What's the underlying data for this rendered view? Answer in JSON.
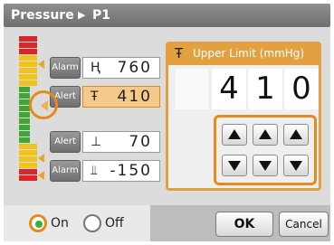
{
  "title": {
    "section": "Pressure",
    "separator": "▶",
    "channel": "P1"
  },
  "limits": [
    {
      "button": "Alarm",
      "symbol": "Ⱨ",
      "value": "760"
    },
    {
      "button": "Alert",
      "symbol": "Ŧ",
      "value": "410"
    },
    {
      "button": "Alert",
      "symbol": "⊥",
      "value": "70"
    },
    {
      "button": "Alarm",
      "symbol": "⫫",
      "value": "-150"
    }
  ],
  "panel": {
    "title": "Upper Limit (mmHg)",
    "digits": [
      "4",
      "1",
      "0"
    ]
  },
  "bottom": {
    "on_label": "On",
    "off_label": "Off",
    "ok_label": "OK",
    "cancel_label": "Cancel"
  },
  "colors": {
    "accent": "#e58b1e",
    "scale_red": "#d8262a",
    "scale_yellow": "#f2c21c",
    "scale_green": "#3fa535"
  }
}
